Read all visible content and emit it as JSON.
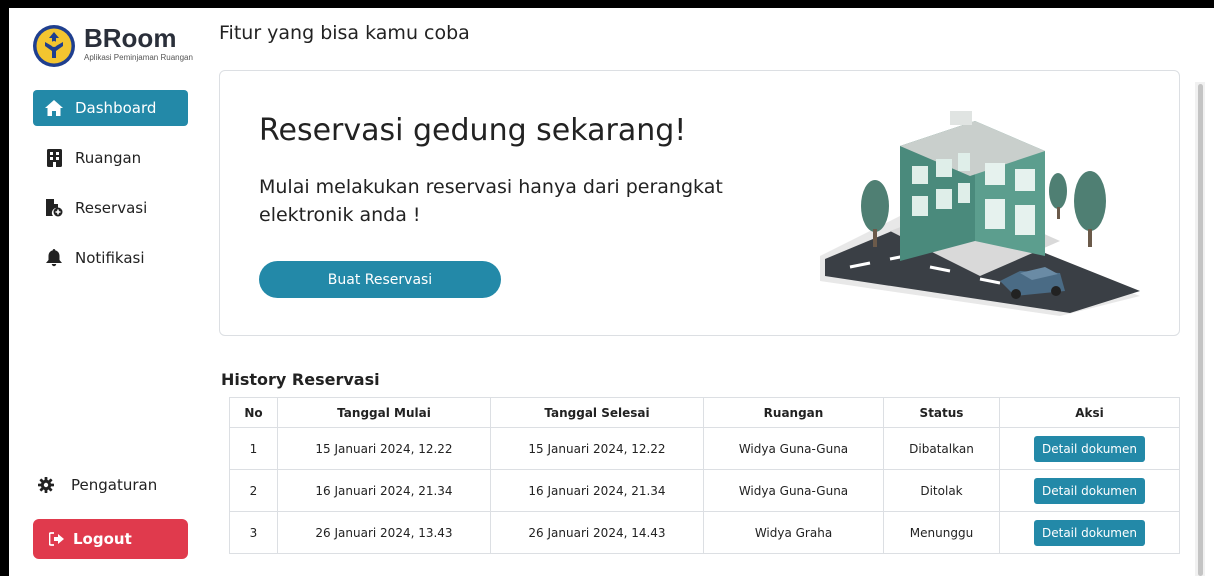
{
  "brand": {
    "name": "BRoom",
    "subtitle": "Aplikasi Peminjaman Ruangan"
  },
  "sidebar": {
    "items": [
      {
        "label": "Dashboard",
        "icon": "home-icon"
      },
      {
        "label": "Ruangan",
        "icon": "building-icon"
      },
      {
        "label": "Reservasi",
        "icon": "file-plus-icon"
      },
      {
        "label": "Notifikasi",
        "icon": "bell-icon"
      }
    ],
    "settings_label": "Pengaturan",
    "logout_label": "Logout"
  },
  "main": {
    "title": "Fitur yang bisa kamu coba",
    "hero": {
      "title": "Reservasi gedung sekarang!",
      "subtitle": "Mulai melakukan reservasi hanya dari perangkat elektronik anda !",
      "button_label": "Buat Reservasi"
    },
    "history": {
      "title": "History Reservasi",
      "columns": [
        "No",
        "Tanggal Mulai",
        "Tanggal Selesai",
        "Ruangan",
        "Status",
        "Aksi"
      ],
      "rows": [
        {
          "no": "1",
          "mulai": "15 Januari 2024, 12.22",
          "selesai": "15 Januari 2024, 12.22",
          "ruangan": "Widya Guna-Guna",
          "status": "Dibatalkan",
          "aksi": "Detail dokumen"
        },
        {
          "no": "2",
          "mulai": "16 Januari 2024, 21.34",
          "selesai": "16 Januari 2024, 21.34",
          "ruangan": "Widya Guna-Guna",
          "status": "Ditolak",
          "aksi": "Detail dokumen"
        },
        {
          "no": "3",
          "mulai": "26 Januari 2024, 13.43",
          "selesai": "26 Januari 2024, 14.43",
          "ruangan": "Widya Graha",
          "status": "Menunggu",
          "aksi": "Detail dokumen"
        }
      ]
    }
  },
  "colors": {
    "accent": "#2389a8",
    "danger": "#e03a4d"
  }
}
